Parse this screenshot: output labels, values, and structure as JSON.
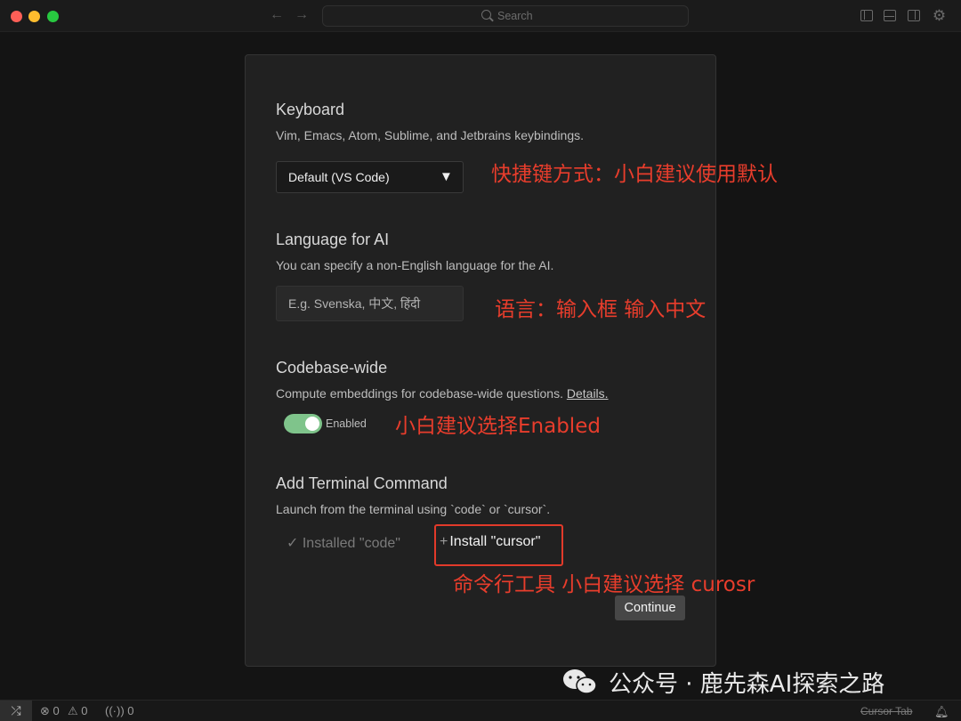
{
  "titlebar": {
    "search_placeholder": "Search",
    "back_icon": "←",
    "forward_icon": "→",
    "gear_icon": "⚙"
  },
  "dialog": {
    "keyboard": {
      "title": "Keyboard",
      "description": "Vim, Emacs, Atom, Sublime, and Jetbrains keybindings.",
      "selected": "Default (VS Code)",
      "caret": "▼"
    },
    "language": {
      "title": "Language for AI",
      "description": "You can specify a non-English language for the AI.",
      "placeholder": "E.g. Svenska, 中文, हिंदी"
    },
    "codebase": {
      "title": "Codebase-wide",
      "description": "Compute embeddings for codebase-wide questions.",
      "details_link": "Details.",
      "toggle_label": "Enabled",
      "toggle_on": true
    },
    "terminal": {
      "title": "Add Terminal Command",
      "description": "Launch from the terminal using `code` or `cursor`.",
      "installed_label": "✓ Installed \"code\"",
      "install_plus": "+",
      "install_label": "Install \"cursor\""
    },
    "continue_label": "Continue"
  },
  "annotations": {
    "keyboard_note": "快捷键方式：小白建议使用默认",
    "language_note": "语言：输入框 输入中文",
    "codebase_note": "小白建议选择Enabled",
    "terminal_note": "命令行工具 小白建议选择 curosr",
    "color": "#e83d2c"
  },
  "watermark": {
    "text": "公众号 · 鹿先森AI探索之路"
  },
  "statusbar": {
    "remote_icon": "⤮",
    "errors": "⊗ 0",
    "warnings": "⚠ 0",
    "ports": "((·)) 0",
    "right_text": "Cursor Tab"
  }
}
